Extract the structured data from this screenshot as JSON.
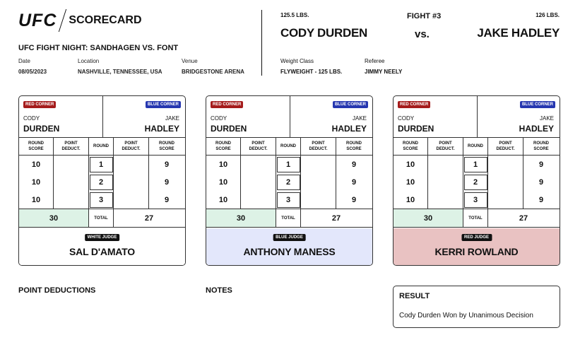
{
  "header": {
    "logo_brand": "UFC",
    "logo_text": "SCORECARD",
    "event_title": "UFC FIGHT NIGHT: SANDHAGEN VS. FONT",
    "date_label": "Date",
    "date_value": "08/05/2023",
    "location_label": "Location",
    "location_value": "NASHVILLE, TENNESSEE, USA",
    "venue_label": "Venue",
    "venue_value": "BRIDGESTONE ARENA"
  },
  "fight": {
    "number": "FIGHT #3",
    "vs": "vs.",
    "red_weight": "125.5 LBS.",
    "red_name": "CODY DURDEN",
    "blue_weight": "126 LBS.",
    "blue_name": "JAKE HADLEY",
    "weight_class_label": "Weight Class",
    "weight_class_value": "FLYWEIGHT - 125 LBS.",
    "referee_label": "Referee",
    "referee_value": "JIMMY NEELY"
  },
  "labels": {
    "red_corner": "RED CORNER",
    "blue_corner": "BLUE CORNER",
    "red_first": "CODY",
    "red_last": "DURDEN",
    "blue_first": "JAKE",
    "blue_last": "HADLEY",
    "round_score_1": "ROUND",
    "round_score_2": "SCORE",
    "point_deduct_1": "POINT",
    "point_deduct_2": "DEDUCT.",
    "round": "ROUND",
    "total": "TOTAL"
  },
  "cards": [
    {
      "judge_role": "WHITE JUDGE",
      "judge_name": "SAL D'AMATO",
      "judge_bg": "#ffffff",
      "rounds": [
        {
          "red": "10",
          "red_ded": "",
          "round": "1",
          "blue_ded": "",
          "blue": "9"
        },
        {
          "red": "10",
          "red_ded": "",
          "round": "2",
          "blue_ded": "",
          "blue": "9"
        },
        {
          "red": "10",
          "red_ded": "",
          "round": "3",
          "blue_ded": "",
          "blue": "9"
        }
      ],
      "red_total": "30",
      "blue_total": "27"
    },
    {
      "judge_role": "BLUE JUDGE",
      "judge_name": "ANTHONY MANESS",
      "judge_bg": "#e3e7fb",
      "rounds": [
        {
          "red": "10",
          "red_ded": "",
          "round": "1",
          "blue_ded": "",
          "blue": "9"
        },
        {
          "red": "10",
          "red_ded": "",
          "round": "2",
          "blue_ded": "",
          "blue": "9"
        },
        {
          "red": "10",
          "red_ded": "",
          "round": "3",
          "blue_ded": "",
          "blue": "9"
        }
      ],
      "red_total": "30",
      "blue_total": "27"
    },
    {
      "judge_role": "RED JUDGE",
      "judge_name": "KERRI ROWLAND",
      "judge_bg": "#e9c2c2",
      "rounds": [
        {
          "red": "10",
          "red_ded": "",
          "round": "1",
          "blue_ded": "",
          "blue": "9"
        },
        {
          "red": "10",
          "red_ded": "",
          "round": "2",
          "blue_ded": "",
          "blue": "9"
        },
        {
          "red": "10",
          "red_ded": "",
          "round": "3",
          "blue_ded": "",
          "blue": "9"
        }
      ],
      "red_total": "30",
      "blue_total": "27"
    }
  ],
  "footer": {
    "point_deductions_title": "POINT DEDUCTIONS",
    "notes_title": "NOTES",
    "result_title": "RESULT",
    "result_text": "Cody Durden Won by Unanimous Decision"
  },
  "colors": {
    "red_corner": "#a51c1c",
    "blue_corner": "#2637b0",
    "total_winner_bg": "#ddf2e6"
  }
}
